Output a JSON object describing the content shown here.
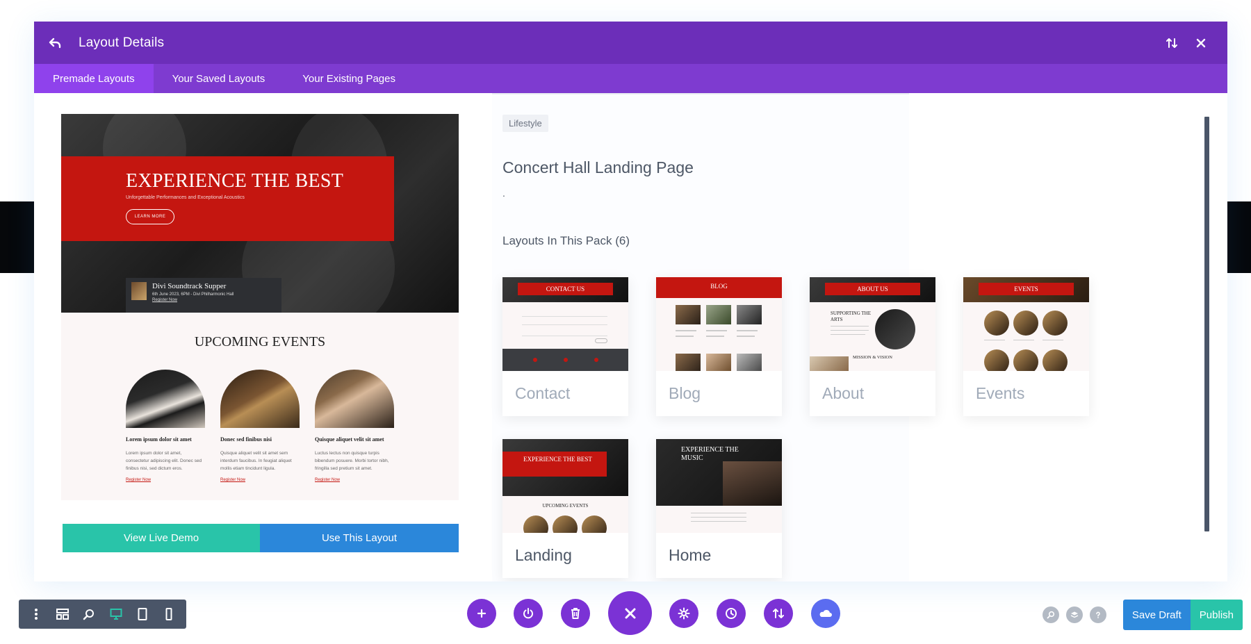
{
  "header": {
    "title": "Layout Details"
  },
  "tabs": [
    {
      "label": "Premade Layouts"
    },
    {
      "label": "Your Saved Layouts"
    },
    {
      "label": "Your Existing Pages"
    }
  ],
  "preview": {
    "hero_title": "EXPERIENCE THE BEST",
    "hero_subtitle": "Unforgettable Performances and Exceptional Acoustics",
    "hero_button": "LEARN MORE",
    "event_name": "Divi Soundtrack Supper",
    "event_date": "6th June 2023, 6PM - Divi Philharmonic Hall",
    "event_link": "Register Now",
    "section_title": "UPCOMING EVENTS",
    "events": [
      {
        "title": "Lorem ipsum dolor sit amet",
        "text": "Lorem ipsum dolor sit amet, consectetur adipiscing elit. Donec sed finibus nisi, sed dictum eros.",
        "link": "Register Now"
      },
      {
        "title": "Donec sed finibus nisi",
        "text": "Quisque aliquet velit sit amet sem interdum faucibus. In feugiat aliquet mollis etiam tincidunt ligula.",
        "link": "Register Now"
      },
      {
        "title": "Quisque aliquet velit sit amet",
        "text": "Luctus lectus non quisque turpis bibendum posuere. Morbi tortor nibh, fringilla sed pretium sit amet.",
        "link": "Register Now"
      }
    ],
    "view_demo_label": "View Live Demo",
    "use_layout_label": "Use This Layout"
  },
  "detail": {
    "category": "Lifestyle",
    "title": "Concert Hall Landing Page",
    "description": ".",
    "pack_heading": "Layouts In This Pack (6)"
  },
  "layouts": [
    {
      "name": "Contact",
      "banner": "CONTACT US"
    },
    {
      "name": "Blog",
      "banner": "BLOG"
    },
    {
      "name": "About",
      "banner": "ABOUT US",
      "thumb_text": "SUPPORTING THE ARTS",
      "thumb_text_2": "MISSION & VISION"
    },
    {
      "name": "Events",
      "banner": "EVENTS"
    },
    {
      "name": "Landing",
      "banner": "EXPERIENCE THE BEST",
      "thumb_text": "UPCOMING EVENTS"
    },
    {
      "name": "Home",
      "thumb_text": "EXPERIENCE THE MUSIC"
    }
  ],
  "footer": {
    "save_draft_label": "Save Draft",
    "publish_label": "Publish"
  },
  "colors": {
    "header": "#6c2eb9",
    "tab_bar": "#7e3bd0",
    "tab_active": "#8f42ec",
    "view_demo": "#29c4a9",
    "use_layout": "#2b87da",
    "brand_red": "#c41610",
    "toolbar_purple": "#7b32d5"
  }
}
